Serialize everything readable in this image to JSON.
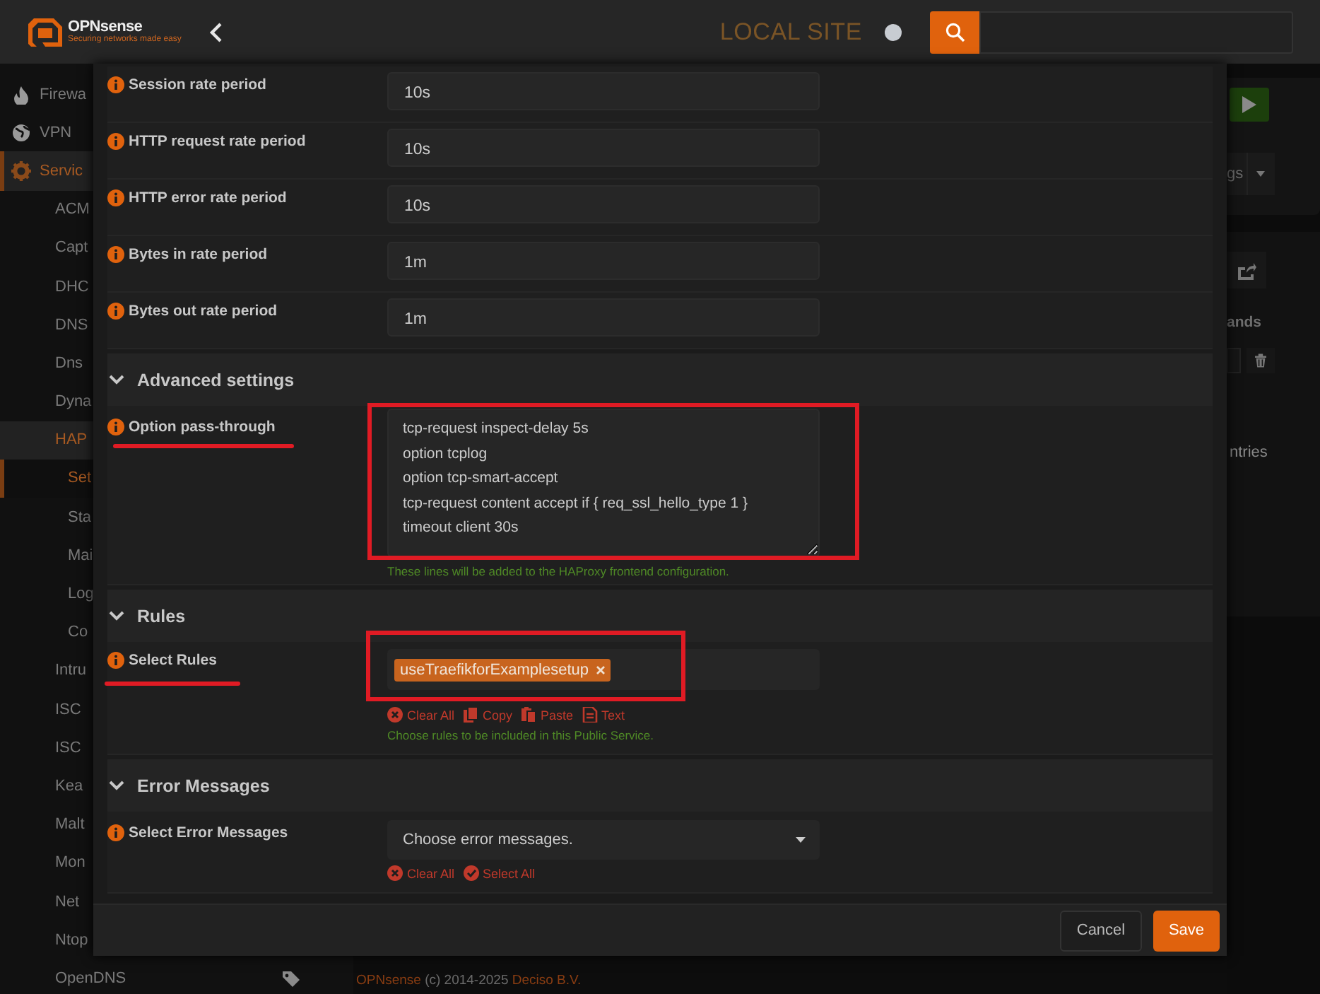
{
  "topbar": {
    "brand": "OPNsense",
    "tagline": "Securing networks made easy",
    "site": "LOCAL SITE"
  },
  "sidebar": {
    "items": [
      {
        "label": "Firewa",
        "selected": false
      },
      {
        "label": "VPN",
        "selected": false
      },
      {
        "label": "Servic",
        "selected": true,
        "expanded": true,
        "children": [
          {
            "label": "ACM",
            "selected": false
          },
          {
            "label": "Capt",
            "selected": false
          },
          {
            "label": "DHC",
            "selected": false
          },
          {
            "label": "DNS",
            "selected": false
          },
          {
            "label": "Dns",
            "selected": false
          },
          {
            "label": "Dyna",
            "selected": false
          },
          {
            "label": "HAP",
            "selected": true,
            "expanded": true,
            "children": [
              {
                "label": "Set",
                "selected": true
              },
              {
                "label": "Sta",
                "selected": false
              },
              {
                "label": "Mai",
                "selected": false
              },
              {
                "label": "Log",
                "selected": false
              },
              {
                "label": "Co",
                "selected": false
              }
            ]
          },
          {
            "label": "Intru",
            "selected": false
          },
          {
            "label": "ISC",
            "selected": false
          },
          {
            "label": "ISC",
            "selected": false
          },
          {
            "label": "Kea",
            "selected": false
          },
          {
            "label": "Malt",
            "selected": false
          },
          {
            "label": "Mon",
            "selected": false
          },
          {
            "label": "Net",
            "selected": false
          },
          {
            "label": "Ntop",
            "selected": false
          },
          {
            "label": "OpenDNS",
            "selected": false
          }
        ]
      }
    ]
  },
  "background_panel": {
    "tab": "gs",
    "column_header": "ands",
    "footer_text": "ntries"
  },
  "footer": {
    "brand_link": "OPNsense",
    "text": "(c) 2014-2025",
    "company_link": "Deciso B.V."
  },
  "dialog": {
    "sections": [
      {
        "rows": [
          {
            "label": "Session rate period",
            "kind": "text",
            "value": "10s",
            "highlighted": false
          },
          {
            "label": "HTTP request rate period",
            "kind": "text",
            "value": "10s",
            "highlighted": false
          },
          {
            "label": "HTTP error rate period",
            "kind": "text",
            "value": "10s",
            "highlighted": false
          },
          {
            "label": "Bytes in rate period",
            "kind": "text",
            "value": "1m",
            "highlighted": false
          },
          {
            "label": "Bytes out rate period",
            "kind": "text",
            "value": "1m",
            "highlighted": false
          }
        ]
      },
      {
        "title": "Advanced settings",
        "expanded": true,
        "rows": [
          {
            "label": "Option pass-through",
            "kind": "textarea",
            "value": "tcp-request inspect-delay 5s\noption tcplog\noption tcp-smart-accept\ntcp-request content accept if { req_ssl_hello_type 1 }\ntimeout client 30s",
            "help": "These lines will be added to the HAProxy frontend configuration.",
            "highlighted": true
          }
        ]
      },
      {
        "title": "Rules",
        "expanded": true,
        "rows": [
          {
            "label": "Select Rules",
            "kind": "tokens",
            "tokens": [
              "useTraefikforExamplesetup"
            ],
            "actions": [
              {
                "kind": "clear",
                "label": "Clear All"
              },
              {
                "kind": "copy",
                "label": "Copy"
              },
              {
                "kind": "paste",
                "label": "Paste"
              },
              {
                "kind": "text",
                "label": "Text"
              }
            ],
            "help": "Choose rules to be included in this Public Service.",
            "highlighted": true
          }
        ]
      },
      {
        "title": "Error Messages",
        "expanded": true,
        "rows": [
          {
            "label": "Select Error Messages",
            "kind": "select",
            "placeholder": "Choose error messages.",
            "actions": [
              {
                "kind": "clear",
                "label": "Clear All"
              },
              {
                "kind": "selectall",
                "label": "Select All"
              }
            ],
            "highlighted": false
          }
        ]
      }
    ],
    "buttons": [
      {
        "label": "Cancel",
        "kind": "secondary"
      },
      {
        "label": "Save",
        "kind": "primary"
      }
    ]
  }
}
